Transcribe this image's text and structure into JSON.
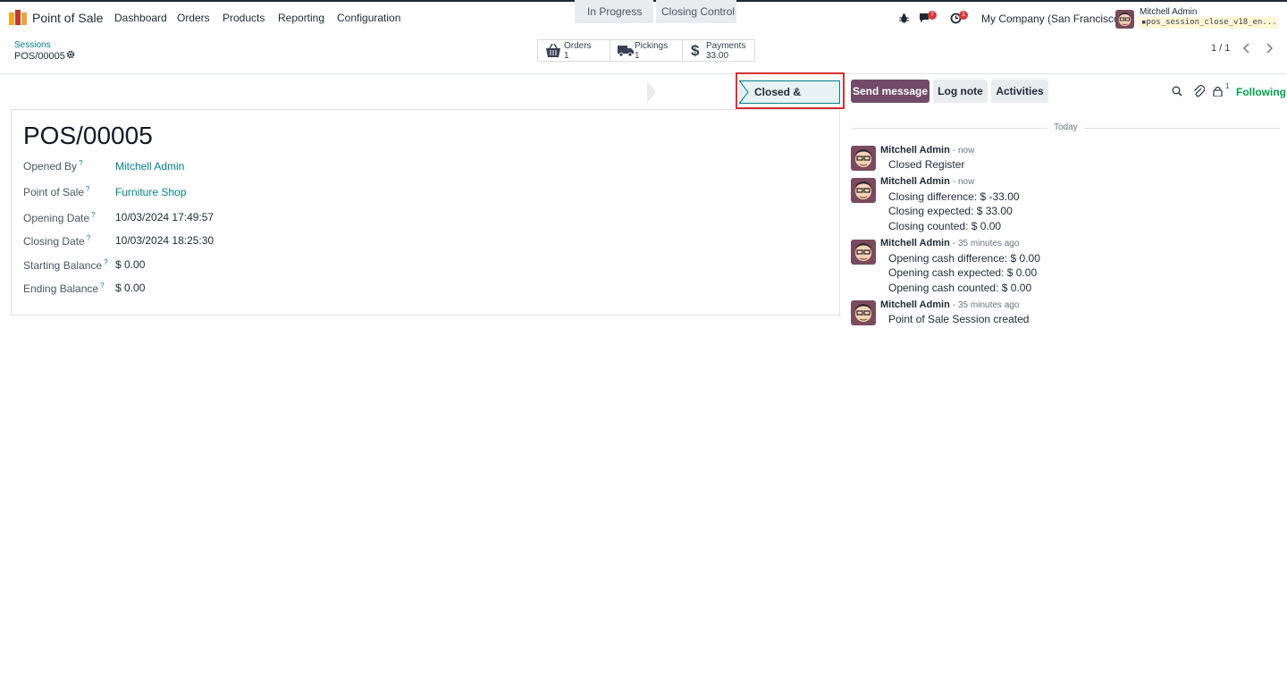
{
  "navbar": {
    "app_name": "Point of Sale",
    "menus": [
      "Dashboard",
      "Orders",
      "Products",
      "Reporting",
      "Configuration"
    ],
    "messages_badge": "7",
    "activities_badge": "1",
    "company": "My Company (San Francisco)",
    "user_name": "Mitchell Admin",
    "database": "pos_session_close_v18_en..."
  },
  "breadcrumb": {
    "parent": "Sessions",
    "current": "POS/00005"
  },
  "smart_buttons": [
    {
      "label": "Orders",
      "value": "1",
      "icon": "basket-icon"
    },
    {
      "label": "Pickings",
      "value": "1",
      "icon": "truck-icon"
    },
    {
      "label": "Payments",
      "value": "33.00",
      "icon": "dollar-icon"
    }
  ],
  "pager": {
    "text": "1 / 1"
  },
  "status": {
    "stages": [
      "In Progress",
      "Closing Control",
      "Closed & Posted"
    ],
    "current": "Closed & Posted"
  },
  "chatter_buttons": {
    "send_message": "Send message",
    "log_note": "Log note",
    "activities": "Activities",
    "followers_count": "1",
    "following": "Following"
  },
  "form": {
    "title": "POS/00005",
    "fields": [
      {
        "label": "Opened By",
        "value": "Mitchell Admin",
        "link": true
      },
      {
        "label": "Point of Sale",
        "value": "Furniture Shop",
        "link": true
      },
      {
        "label": "Opening Date",
        "value": "10/03/2024 17:49:57",
        "link": false
      },
      {
        "label": "Closing Date",
        "value": "10/03/2024 18:25:30",
        "link": false
      },
      {
        "label": "Starting Balance",
        "value": "$ 0.00",
        "link": false
      },
      {
        "label": "Ending Balance",
        "value": "$ 0.00",
        "link": false
      }
    ]
  },
  "chatter": {
    "date_separator": "Today",
    "messages": [
      {
        "author": "Mitchell Admin",
        "time": "- now",
        "lines": [
          "Closed Register"
        ]
      },
      {
        "author": "Mitchell Admin",
        "time": "- now",
        "lines": [
          "Closing difference: $ -33.00",
          "Closing expected: $ 33.00",
          "Closing counted: $ 0.00"
        ]
      },
      {
        "author": "Mitchell Admin",
        "time": "- 35 minutes ago",
        "lines": [
          "Opening cash difference: $ 0.00",
          "Opening cash expected: $ 0.00",
          "Opening cash counted: $ 0.00"
        ]
      },
      {
        "author": "Mitchell Admin",
        "time": "- 35 minutes ago",
        "lines": [
          "Point of Sale Session created"
        ]
      }
    ]
  },
  "colors": {
    "brand": "#714b67",
    "accent": "#017e84",
    "following": "#00a04a",
    "highlight": "#d63030"
  }
}
